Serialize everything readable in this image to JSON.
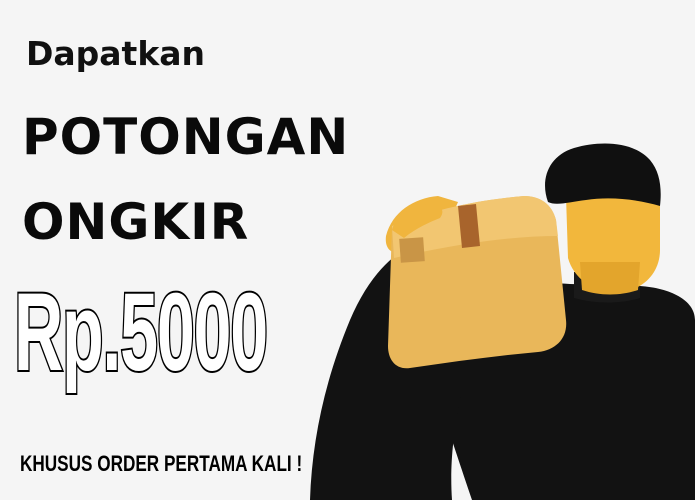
{
  "promo": {
    "intro": "Dapatkan",
    "headline_line1": "POTONGAN",
    "headline_line2": "ONGKIR",
    "price": "Rp.5000",
    "note": "KHUSUS ORDER PERTAMA KALI !"
  },
  "colors": {
    "background": "#f5f5f5",
    "text": "#0a0a0a",
    "shirt": "#121212",
    "skin": "#f2b73c",
    "box": "#e9b75a",
    "tape": "#a8642c"
  },
  "icons": {
    "courier": "delivery-courier-illustration",
    "box": "package-box-icon"
  }
}
